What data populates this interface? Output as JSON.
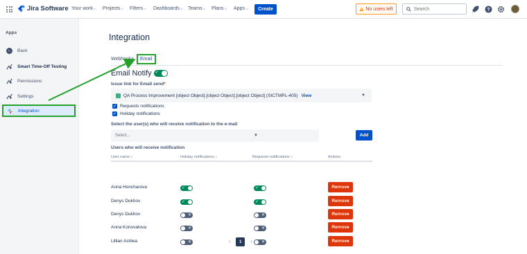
{
  "topnav": {
    "product": "Jira Software",
    "menus": [
      "Your work",
      "Projects",
      "Filters",
      "Dashboards",
      "Teams",
      "Plans",
      "Apps"
    ],
    "create_label": "Create",
    "users_left": "No users left",
    "search_placeholder": "Search"
  },
  "sidebar": {
    "heading": "Apps",
    "items": [
      {
        "label": "Back"
      },
      {
        "label": "Smart Time-Off Testing"
      },
      {
        "label": "Permissions"
      },
      {
        "label": "Settings"
      },
      {
        "label": "Integration"
      }
    ]
  },
  "main": {
    "title": "Integration",
    "tabs": [
      "Webhooks",
      "Email"
    ],
    "email_notify_title": "Email Notify",
    "email_notify_enabled": true,
    "issue_link_label": "Issue link for Email send",
    "issue_value": "QA Process Improvement [object Object].[object Object].[object Object] (SICTMPL-405)",
    "view_label": "View",
    "checkboxes": [
      {
        "label": "Requests notifications",
        "checked": true
      },
      {
        "label": "Holiday notifications",
        "checked": true
      }
    ],
    "select_users_label": "Select the user(s) who will receive notification to the e-mail",
    "select_placeholder": "Select...",
    "add_label": "Add",
    "users_heading": "Users who will receive notification",
    "table": {
      "headers": [
        "User name",
        "Holiday notifications",
        "Requests notifications",
        "Actions"
      ],
      "rows": [
        {
          "name": "Anna Honcharova",
          "holiday": true,
          "requests": true,
          "action": "Remove"
        },
        {
          "name": "Denys Dukhov",
          "holiday": true,
          "requests": true,
          "action": "Remove"
        },
        {
          "name": "Denys Dukhov",
          "holiday": false,
          "requests": false,
          "action": "Remove"
        },
        {
          "name": "Anna Konovalova",
          "holiday": false,
          "requests": false,
          "action": "Remove"
        },
        {
          "name": "Lillian Ashlea",
          "holiday": false,
          "requests": false,
          "action": "Remove"
        }
      ]
    },
    "pagination": {
      "current": "1"
    }
  },
  "colors": {
    "brand": "#0052cc",
    "success": "#00875a",
    "danger": "#de350b",
    "annotation": "#22a02a"
  }
}
